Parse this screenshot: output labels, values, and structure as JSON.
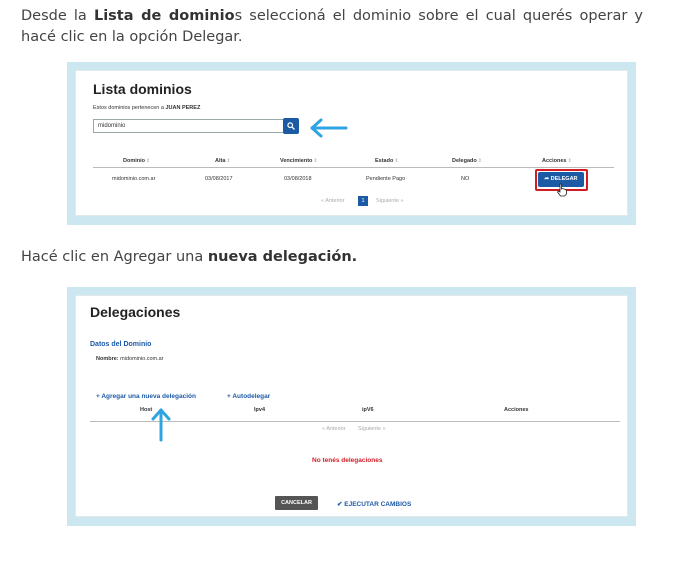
{
  "step1": {
    "text_before": "Desde la ",
    "bold_1": "Lista de dominio",
    "text_after": "s seleccioná el dominio sobre el cual querés operar y hacé clic en la opción Delegar."
  },
  "screenshot1": {
    "title": "Lista dominios",
    "subtitle_prefix": "Estos dominios pertenecen a ",
    "owner": "JUAN PEREZ",
    "search_value": "midominio",
    "columns": [
      "Dominio",
      "Alta",
      "Vencimiento",
      "Estado",
      "Delegado",
      "Acciones"
    ],
    "row": [
      "midominio.com.ar",
      "03/08/2017",
      "03/08/2018",
      "Pendiente Pago",
      "NO"
    ],
    "delegar_label": "DELEGAR",
    "pager_prev": "« Anterior",
    "pager_page": "1",
    "pager_next": "Siguiente »",
    "highlight_color": "#d21c24",
    "accent_color": "#1d5aa5"
  },
  "step2": {
    "text_before": "Hacé clic en Agregar una ",
    "bold_1": "nueva delegación."
  },
  "screenshot2": {
    "title": "Delegaciones",
    "section_title": "Datos del Dominio",
    "name_label": "Nombre:",
    "name_value": "midominio.com.ar",
    "add_link": "+ Agregar una nueva delegación",
    "autodelegar_link": "+ Autodelegar",
    "columns": [
      "Host",
      "Ipv4",
      "ipV6",
      "Acciones"
    ],
    "pager_prev": "« Anterior",
    "pager_next": "Siguiente »",
    "empty_message": "No tenés delegaciones",
    "cancel_label": "CANCELAR",
    "execute_label": "✔ EJECUTAR CAMBIOS"
  }
}
